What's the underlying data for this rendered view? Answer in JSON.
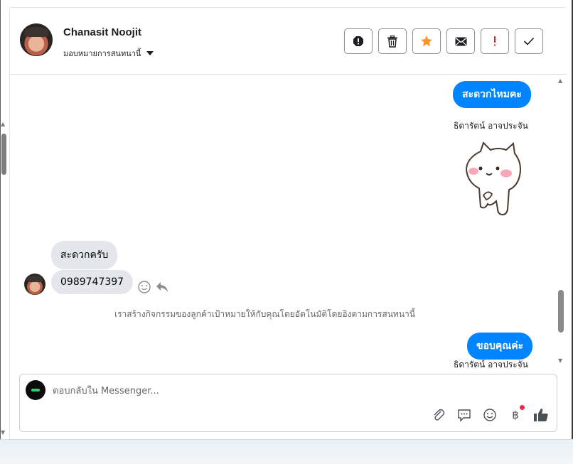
{
  "contact": {
    "name": "Chanasit Noojit",
    "assign_label": "มอบหมายการสนทนานี้"
  },
  "toolbar": {
    "buttons": [
      "mark-spam",
      "delete",
      "star",
      "mark-unread",
      "follow-up",
      "done"
    ],
    "colors": {
      "star": "#f5962b",
      "follow_up": "#e41e3f"
    }
  },
  "messages": {
    "outgoing_1": "สะดวกไหมคะ",
    "sender_1": "ธิดารัตน์ อาจประจัน",
    "incoming_1": "สะดวกครับ",
    "incoming_2": "0989747397",
    "system_note": "เราสร้างกิจกรรมของลูกค้าเป้าหมายให้กับคุณโดยอัตโนมัติโดยอิงตามการสนทนานี้",
    "outgoing_2": "ขอบคุณค่ะ",
    "sender_2": "ธิดารัตน์ อาจประจัน"
  },
  "composer": {
    "placeholder": "ตอบกลับใน Messenger...",
    "currency_symbol": "฿"
  },
  "colors": {
    "outgoing_bubble": "#0084ff",
    "incoming_bubble": "#e4e6eb"
  }
}
